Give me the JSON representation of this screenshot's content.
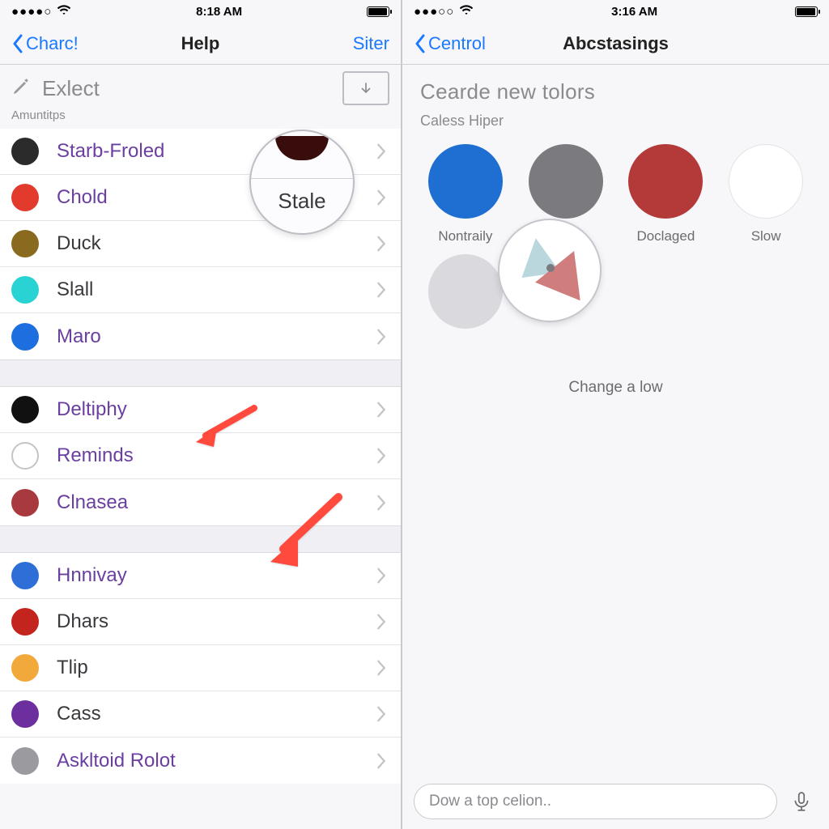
{
  "left": {
    "status": {
      "dots": "●●●●○",
      "time": "8:18 AM"
    },
    "nav": {
      "back": "Charc!",
      "title": "Help",
      "action": "Siter"
    },
    "exlect_label": "Exlect",
    "section_header": "Amuntitps",
    "bubble_text": "Stale",
    "groups": [
      [
        {
          "color": "#2b2b2b",
          "label": "Starb-Froled",
          "label_style": "purple"
        },
        {
          "color": "#e23b2e",
          "label": "Chold",
          "label_style": "purple"
        },
        {
          "color": "#8a6a1e",
          "label": "Duck",
          "label_style": "dark"
        },
        {
          "color": "#29d3d3",
          "label": "Slall",
          "label_style": "dark"
        },
        {
          "color": "#1d6fe0",
          "label": "Maro",
          "label_style": "purple"
        }
      ],
      [
        {
          "color": "#111111",
          "label": "Deltiphy",
          "label_style": "purple"
        },
        {
          "color": "#ffffff",
          "label": "Reminds",
          "label_style": "purple",
          "outline": true
        },
        {
          "color": "#a83a3f",
          "label": "Clnasea",
          "label_style": "purple"
        }
      ],
      [
        {
          "color": "#2d6fd6",
          "label": "Hnnivay",
          "label_style": "purple"
        },
        {
          "color": "#c4241e",
          "label": "Dhars",
          "label_style": "dark"
        },
        {
          "color": "#f2a93b",
          "label": "Tlip",
          "label_style": "dark"
        },
        {
          "color": "#6d2e9e",
          "label": "Cass",
          "label_style": "dark"
        },
        {
          "color": "#9a9a9f",
          "label": "Askltoid Rolot",
          "label_style": "purple"
        }
      ]
    ]
  },
  "right": {
    "status": {
      "dots": "●●●○○",
      "time": "3:16 AM"
    },
    "nav": {
      "back": "Centrol",
      "title": "Abcstasings"
    },
    "heading": "Cearde new tolors",
    "caption": "Caless Hiper",
    "swatches": [
      {
        "color": "#1f6fd2",
        "label": "Nontraily"
      },
      {
        "color": "#7a7a7f",
        "label": ""
      },
      {
        "color": "#b43a3a",
        "label": "Doclaged"
      },
      {
        "color": "#ffffff",
        "label": "Slow",
        "outline": true
      }
    ],
    "extra_swatch_color": "#d9d9de",
    "center_note": "Change a low",
    "input_placeholder": "Dow a top celion.."
  },
  "colors": {
    "ios_blue": "#1979ff",
    "arrow": "#ff4a3d"
  }
}
